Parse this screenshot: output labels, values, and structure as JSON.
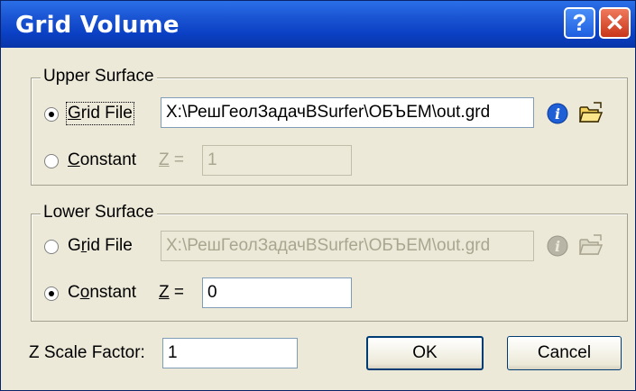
{
  "window": {
    "title": "Grid Volume",
    "help_glyph": "?",
    "close_glyph": "✕"
  },
  "upper": {
    "group_label": "Upper Surface",
    "gridfile_label_u": "G",
    "gridfile_label_rest": "rid File",
    "gridfile_value": "X:\\РешГеолЗадачBSurfer\\ОБЪЕМ\\out.grd",
    "constant_label_u": "C",
    "constant_label_rest": "onstant",
    "z_label_u": "Z",
    "z_label_rest": " =",
    "z_value": "1"
  },
  "lower": {
    "group_label": "Lower Surface",
    "gridfile_label_pre": "G",
    "gridfile_label_u": "r",
    "gridfile_label_rest": "id File",
    "gridfile_value": "X:\\РешГеолЗадачBSurfer\\ОБЪЕМ\\out.grd",
    "constant_label_pre": "C",
    "constant_label_u": "o",
    "constant_label_rest": "nstant",
    "z_label_u": "Z",
    "z_label_rest": " =",
    "z_value": "0"
  },
  "zscale": {
    "label": "Z Scale Factor:",
    "value": "1"
  },
  "buttons": {
    "ok": "OK",
    "cancel": "Cancel"
  }
}
